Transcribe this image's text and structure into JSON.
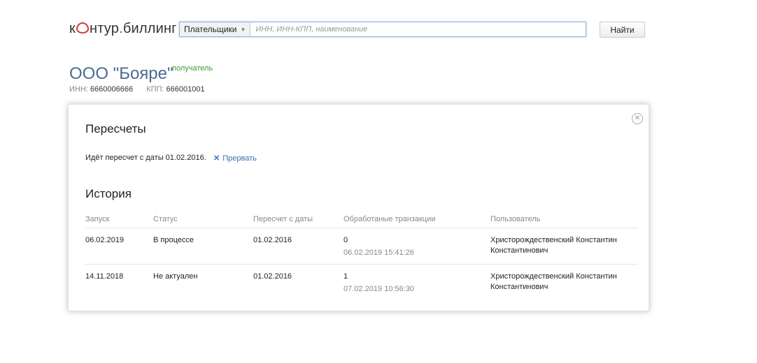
{
  "header": {
    "logo_left": "к",
    "logo_right": "нтур",
    "logo_dot": ".",
    "logo_suffix": "биллинг",
    "search_select": "Плательщики",
    "search_placeholder": "ИНН, ИНН-КПП, наименование",
    "find_label": "Найти"
  },
  "org": {
    "name": "ООО \"Бояре\"",
    "role": "получатель",
    "inn_label": "ИНН:",
    "inn": "6660006666",
    "kpp_label": "КПП:",
    "kpp": "666001001"
  },
  "panel": {
    "title": "Пересчеты",
    "status": "Идёт пересчет с даты 01.02.2016.",
    "abort_label": "Прервать",
    "history_title": "История",
    "columns": [
      "Запуск",
      "Статус",
      "Пересчет с даты",
      "Обработаные транзакции",
      "Пользователь"
    ],
    "rows": [
      {
        "launch": "06.02.2019",
        "status": "В процессе",
        "from_date": "01.02.2016",
        "tx_count": "0",
        "tx_time": "06.02.2019 15:41:26",
        "user_line1": "Христорождественский Константин",
        "user_line2": "Константинович"
      },
      {
        "launch": "14.11.2018",
        "status": "Не актуален",
        "from_date": "01.02.2016",
        "tx_count": "1",
        "tx_time": "07.02.2019 10:56:30",
        "user_line1": "Христорождественский Константин",
        "user_line2": "Константинович"
      }
    ]
  },
  "colors": {
    "accent": "#4a6b8f",
    "logo_red": "#d6373c",
    "role_green": "#3a9a3a",
    "link_blue": "#3c6fb0"
  },
  "icons": {
    "close": "close-circle-icon",
    "abort": "x-icon",
    "caret": "chevron-down-icon"
  }
}
